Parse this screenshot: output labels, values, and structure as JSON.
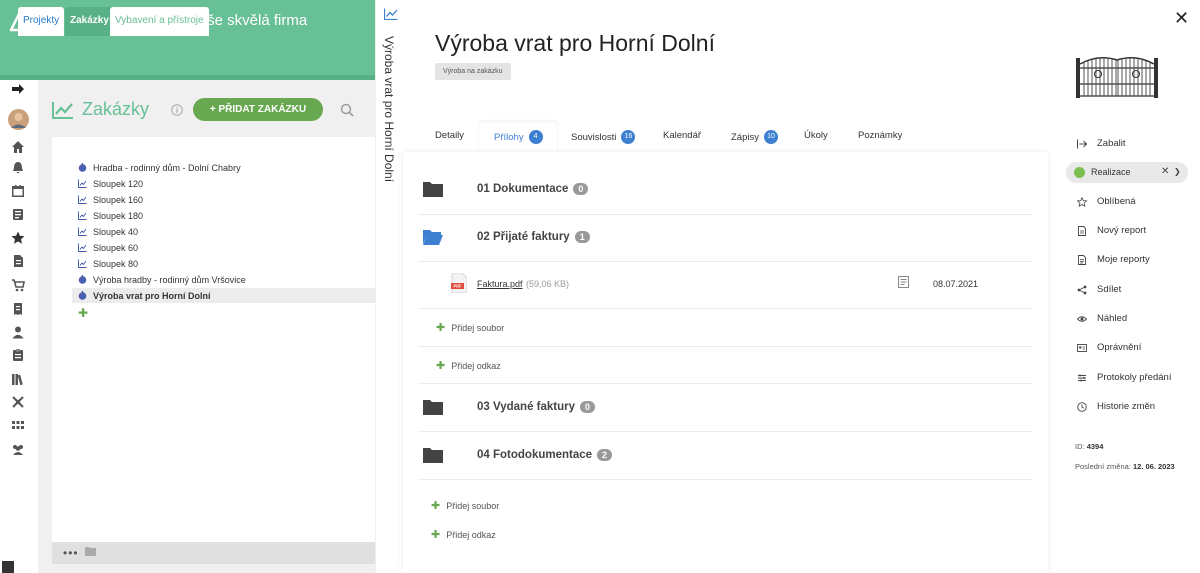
{
  "header": {
    "logo_text": "aptien",
    "company": "Naše skvělá firma"
  },
  "module_tabs": [
    {
      "label": "Projekty"
    },
    {
      "label": "Zakázky"
    },
    {
      "label": "Vybavení a přístroje"
    }
  ],
  "orders": {
    "title": "Zakázky",
    "add_button": "+ PŘIDAT ZAKÁZKU",
    "items": [
      {
        "label": "Hradba - rodinný dům - Dolní Chabry",
        "icon": "order-icon"
      },
      {
        "label": "Sloupek 120",
        "icon": "chart-icon"
      },
      {
        "label": "Sloupek 160",
        "icon": "chart-icon"
      },
      {
        "label": "Sloupek 180",
        "icon": "chart-icon"
      },
      {
        "label": "Sloupek 40",
        "icon": "chart-icon"
      },
      {
        "label": "Sloupek 60",
        "icon": "chart-icon"
      },
      {
        "label": "Sloupek 80",
        "icon": "chart-icon"
      },
      {
        "label": "Výroba hradby - rodinný dům Vršovice",
        "icon": "order-icon"
      },
      {
        "label": "Výroba vrat pro Horní Dolní",
        "icon": "order-icon",
        "selected": true
      }
    ]
  },
  "vertical_title": "Výroba vrat pro Horní Dolní",
  "detail": {
    "title": "Výroba vrat pro Horní Dolní",
    "type_badge": "Výroba na zakázku",
    "tabs": [
      {
        "label": "Detaily",
        "count": ""
      },
      {
        "label": "Přílohy",
        "count": "4"
      },
      {
        "label": "Souvislosti",
        "count": "16"
      },
      {
        "label": "Kalendář",
        "count": ""
      },
      {
        "label": "Zápisy",
        "count": "10"
      },
      {
        "label": "Úkoly",
        "count": ""
      },
      {
        "label": "Poznámky",
        "count": ""
      }
    ],
    "folders": [
      {
        "name": "01 Dokumentace",
        "count": "0"
      },
      {
        "name": "02 Přijaté faktury",
        "count": "1"
      },
      {
        "name": "03 Vydané faktury",
        "count": "0"
      },
      {
        "name": "04 Fotodokumentace",
        "count": "2"
      }
    ],
    "file": {
      "name": "Faktura.pdf",
      "size": "(59,06 KB)",
      "date": "08.07.2021"
    },
    "add_file": "Přidej soubor",
    "add_link": "Přidej odkaz"
  },
  "actions": {
    "items": [
      {
        "label": "Zabalit",
        "icon": "collapse-icon"
      },
      {
        "label": "Oblíbená",
        "icon": "star-icon"
      },
      {
        "label": "Nový report",
        "icon": "report-icon"
      },
      {
        "label": "Moje reporty",
        "icon": "reports-icon"
      },
      {
        "label": "Sdílet",
        "icon": "share-icon"
      },
      {
        "label": "Náhled",
        "icon": "eye-icon"
      },
      {
        "label": "Oprávnění",
        "icon": "permissions-icon"
      },
      {
        "label": "Protokoly předání",
        "icon": "protocol-icon"
      },
      {
        "label": "Historie změn",
        "icon": "history-icon"
      }
    ],
    "status": "Realizace",
    "id_label": "ID:",
    "id_value": "4394",
    "last_change_label": "Poslední změna:",
    "last_change_value": "12. 06. 2023"
  },
  "colors": {
    "brand": "#68c097",
    "accent_button": "#68a850",
    "badge": "#3d7fd1",
    "status_dot": "#7bc04e"
  }
}
